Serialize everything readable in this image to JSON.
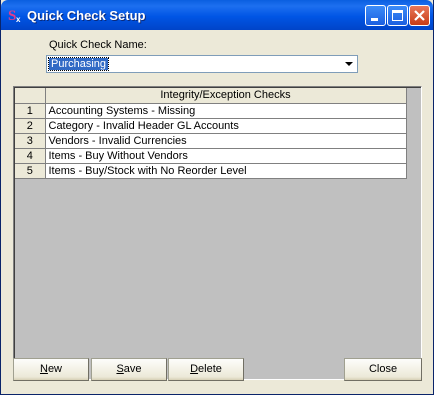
{
  "window": {
    "title": "Quick Check Setup"
  },
  "form": {
    "name_label": "Quick Check Name:",
    "name_value": "Purchasing"
  },
  "grid": {
    "header": "Integrity/Exception Checks",
    "rows": [
      {
        "num": "1",
        "text": "Accounting Systems - Missing"
      },
      {
        "num": "2",
        "text": "Category - Invalid Header GL Accounts"
      },
      {
        "num": "3",
        "text": "Vendors - Invalid Currencies"
      },
      {
        "num": "4",
        "text": "Items - Buy Without Vendors"
      },
      {
        "num": "5",
        "text": "Items - Buy/Stock with No Reorder Level"
      }
    ]
  },
  "buttons": {
    "new": {
      "accel": "N",
      "rest": "ew"
    },
    "save": {
      "accel": "S",
      "rest": "ave"
    },
    "delete": {
      "accel": "D",
      "rest": "elete"
    },
    "close": "Close"
  },
  "icons": [
    "app-icon",
    "minimize-icon",
    "maximize-icon",
    "close-icon",
    "dropdown-arrow-icon"
  ]
}
